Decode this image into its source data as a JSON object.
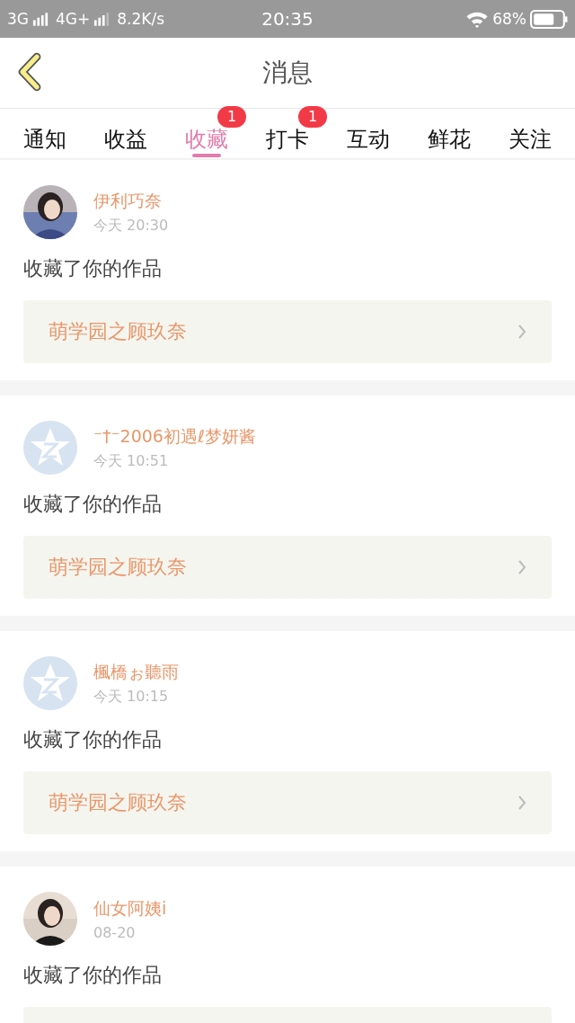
{
  "status_bar": {
    "network_1": "3G",
    "network_2": "4G+",
    "speed": "8.2K/s",
    "time": "20:35",
    "battery": "68%"
  },
  "header": {
    "title": "消息"
  },
  "tabs": [
    {
      "label": "通知",
      "selected": false
    },
    {
      "label": "收益",
      "selected": false
    },
    {
      "label": "收藏",
      "selected": true,
      "badge": "1"
    },
    {
      "label": "打卡",
      "selected": false,
      "badge": "1"
    },
    {
      "label": "互动",
      "selected": false
    },
    {
      "label": "鲜花",
      "selected": false
    },
    {
      "label": "关注",
      "selected": false
    }
  ],
  "messages": [
    {
      "name": "伊利巧奈",
      "time": "今天 20:30",
      "action": "收藏了你的作品",
      "work": "萌学园之顾玖奈"
    },
    {
      "kind": "default",
      "name": "⁻†⁻2006初遇ℓ梦妍酱",
      "time": "今天 10:51",
      "action": "收藏了你的作品",
      "work": "萌学园之顾玖奈"
    },
    {
      "kind": "default",
      "name": "楓橋ぉ聽雨",
      "time": "今天 10:15",
      "action": "收藏了你的作品",
      "work": "萌学园之顾玖奈"
    },
    {
      "name": "仙女阿姨i",
      "time": "08-20",
      "action": "收藏了你的作品"
    }
  ]
}
